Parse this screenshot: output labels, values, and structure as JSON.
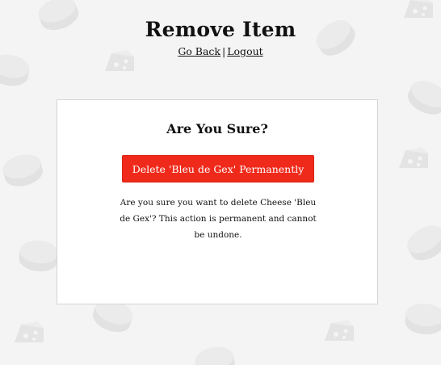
{
  "page": {
    "title": "Remove Item"
  },
  "nav": {
    "go_back": "Go Back",
    "separator": "|",
    "logout": "Logout"
  },
  "dialog": {
    "heading": "Are You Sure?",
    "delete_button_label": "Delete 'Bleu de Gex' Permanently",
    "message": "Are you sure you want to delete Cheese 'Bleu de Gex'? This action is permanent and cannot be undone."
  },
  "colors": {
    "background": "#f4f4f4",
    "danger": "#ef2a1b",
    "card": "#ffffff",
    "pattern": "#e4e4e4"
  },
  "background_pattern_icons": [
    "cheese-wheel-icon",
    "cheese-wedge-icon"
  ]
}
